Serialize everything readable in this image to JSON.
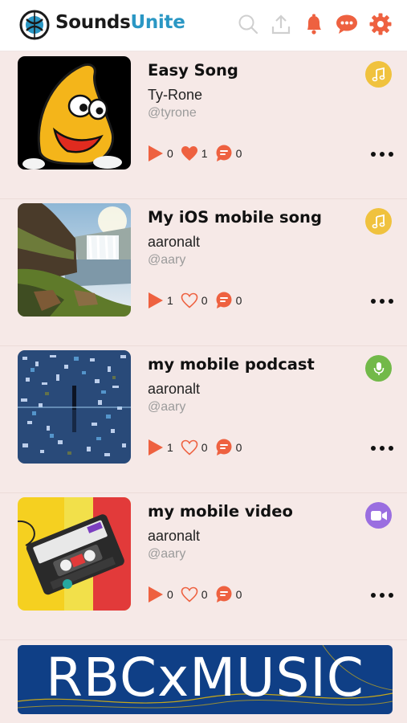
{
  "app": {
    "brand_part1": "Sounds",
    "brand_part2": "Unite",
    "accent_color": "#ee6140",
    "brand_color": "#2a97c4"
  },
  "header": {
    "icons": [
      "search-icon",
      "upload-icon",
      "bell-icon",
      "chat-icon",
      "gear-icon"
    ]
  },
  "feed": {
    "items": [
      {
        "title": "Easy Song",
        "artist": "Ty-Rone",
        "handle": "@tyrone",
        "type": "music",
        "plays": "0",
        "likes": "1",
        "liked": true,
        "comments": "0"
      },
      {
        "title": "My iOS mobile song",
        "artist": "aaronalt",
        "handle": "@aary",
        "type": "music",
        "plays": "1",
        "likes": "0",
        "liked": false,
        "comments": "0"
      },
      {
        "title": "my mobile podcast",
        "artist": "aaronalt",
        "handle": "@aary",
        "type": "podcast",
        "plays": "1",
        "likes": "0",
        "liked": false,
        "comments": "0"
      },
      {
        "title": "my mobile video",
        "artist": "aaronalt",
        "handle": "@aary",
        "type": "video",
        "plays": "0",
        "likes": "0",
        "liked": false,
        "comments": "0"
      }
    ]
  },
  "banner": {
    "text": "RBCxMUSIC"
  },
  "colors": {
    "music_badge": "#f0c23e",
    "podcast_badge": "#72b949",
    "video_badge": "#9a6ee0",
    "background": "#f6e9e7"
  }
}
